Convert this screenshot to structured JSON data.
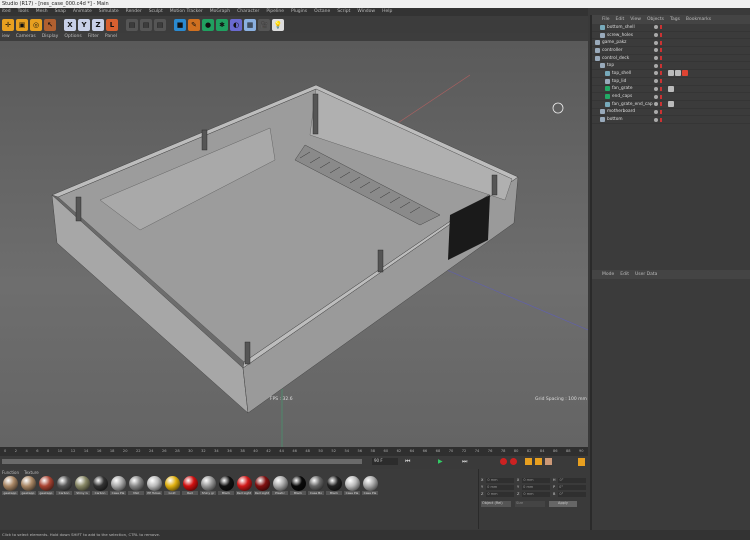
{
  "window": {
    "title": "Studio (R17) - [nes_case_000.c4d *] - Main"
  },
  "menu": [
    "ited",
    "Tools",
    "Mesh",
    "Snap",
    "Animate",
    "Simulate",
    "Render",
    "Sculpt",
    "Motion Tracker",
    "MoGraph",
    "Character",
    "Pipeline",
    "Plugins",
    "Octane",
    "Script",
    "Window",
    "Help"
  ],
  "toolbar": {
    "icons": [
      {
        "name": "move-icon",
        "color": "#e8a020",
        "glyph": "✛"
      },
      {
        "name": "scale-icon",
        "color": "#e8a020",
        "glyph": "▣"
      },
      {
        "name": "rotate-icon",
        "color": "#e8a020",
        "glyph": "◎"
      },
      {
        "name": "select-icon",
        "color": "#b06030",
        "glyph": "↖"
      },
      {
        "name": "x-axis-icon",
        "color": "#c8d0e8",
        "glyph": "X"
      },
      {
        "name": "y-axis-icon",
        "color": "#c8d0e8",
        "glyph": "Y"
      },
      {
        "name": "z-axis-icon",
        "color": "#c8d0e8",
        "glyph": "Z"
      },
      {
        "name": "coordinate-system-icon",
        "color": "#d86030",
        "glyph": "L"
      },
      {
        "name": "render-view-icon",
        "color": "#555",
        "glyph": "▤"
      },
      {
        "name": "render-picture-icon",
        "color": "#555",
        "glyph": "▤"
      },
      {
        "name": "render-settings-icon",
        "color": "#555",
        "glyph": "▤"
      },
      {
        "name": "cube-icon",
        "color": "#2a8ad0",
        "glyph": "■"
      },
      {
        "name": "pen-icon",
        "color": "#d07020",
        "glyph": "✎"
      },
      {
        "name": "subdivision-icon",
        "color": "#20a060",
        "glyph": "●"
      },
      {
        "name": "array-icon",
        "color": "#20a060",
        "glyph": "✱"
      },
      {
        "name": "deformer-icon",
        "color": "#6a6ad0",
        "glyph": "◐"
      },
      {
        "name": "floor-icon",
        "color": "#8ab0e0",
        "glyph": "▦"
      },
      {
        "name": "camera-icon",
        "color": "#555",
        "glyph": "🎥"
      },
      {
        "name": "light-icon",
        "color": "#ddd",
        "glyph": "💡"
      }
    ]
  },
  "viewport_menu": [
    "iew",
    "Cameras",
    "Display",
    "Options",
    "Filter",
    "Panel"
  ],
  "viewport": {
    "fps": "FPS : 32.6",
    "grid_spacing": "Grid Spacing : 100 mm"
  },
  "object_manager": {
    "menu": [
      "File",
      "Edit",
      "View",
      "Objects",
      "Tags",
      "Bookmarks"
    ],
    "objects": [
      {
        "name": "bottom_shell",
        "indent": 1,
        "icon": "#7ab"
      },
      {
        "name": "screw_holes",
        "indent": 1,
        "icon": "#9ab"
      },
      {
        "name": "game_pakz",
        "indent": 0,
        "icon": "#9ab"
      },
      {
        "name": "controller",
        "indent": 0,
        "icon": "#9ab"
      },
      {
        "name": "control_deck",
        "indent": 0,
        "icon": "#9ab"
      },
      {
        "name": "top",
        "indent": 1,
        "icon": "#9ab"
      },
      {
        "name": "top_shell",
        "indent": 2,
        "icon": "#7ab",
        "tags": 3
      },
      {
        "name": "top_lid",
        "indent": 2,
        "icon": "#9ab"
      },
      {
        "name": "fan_grate",
        "indent": 2,
        "icon": "#2a6",
        "tags": 1
      },
      {
        "name": "end_caps",
        "indent": 2,
        "icon": "#2a6"
      },
      {
        "name": "fan_grate_end_cap",
        "indent": 2,
        "icon": "#7ab",
        "tags": 1
      },
      {
        "name": "motherboard",
        "indent": 1,
        "icon": "#9ab"
      },
      {
        "name": "bottom",
        "indent": 1,
        "icon": "#9ab"
      }
    ]
  },
  "attributes": {
    "menu": [
      "Mode",
      "Edit",
      "User Data"
    ]
  },
  "timeline": {
    "ticks": [
      "0",
      "2",
      "4",
      "6",
      "8",
      "10",
      "12",
      "14",
      "16",
      "18",
      "20",
      "22",
      "24",
      "26",
      "28",
      "30",
      "32",
      "34",
      "36",
      "38",
      "40",
      "42",
      "44",
      "46",
      "48",
      "50",
      "52",
      "54",
      "56",
      "58",
      "60",
      "62",
      "64",
      "66",
      "68",
      "70",
      "72",
      "74",
      "76",
      "78",
      "80",
      "82",
      "84",
      "86",
      "88",
      "90"
    ],
    "current_frame": "90 F",
    "end": "0 F"
  },
  "materials": {
    "menu": [
      "Function",
      "Texture"
    ],
    "items": [
      {
        "label": "geekapp",
        "color": "#a86"
      },
      {
        "label": "geekapp",
        "color": "#a86"
      },
      {
        "label": "geekapp",
        "color": "#a43"
      },
      {
        "label": "Carbon",
        "color": "#555"
      },
      {
        "label": "Shiny G",
        "color": "#886"
      },
      {
        "label": "Carbon",
        "color": "#333"
      },
      {
        "label": "Case Pla",
        "color": "#aaa"
      },
      {
        "label": "Mat",
        "color": "#888"
      },
      {
        "label": "PP Tubes",
        "color": "#bbb"
      },
      {
        "label": "Gold",
        "color": "#e0b010"
      },
      {
        "label": "Red",
        "color": "#d01010"
      },
      {
        "label": "Shiny gr",
        "color": "#999"
      },
      {
        "label": "Black",
        "color": "#111"
      },
      {
        "label": "Red Light",
        "color": "#d01818"
      },
      {
        "label": "Red Light",
        "color": "#801010"
      },
      {
        "label": "Plastic",
        "color": "#aaa"
      },
      {
        "label": "Black",
        "color": "#0a0a0a"
      },
      {
        "label": "Case Bo",
        "color": "#666"
      },
      {
        "label": "Black",
        "color": "#222"
      },
      {
        "label": "Case Pla",
        "color": "#bbb"
      },
      {
        "label": "Case Pla",
        "color": "#aaa"
      }
    ]
  },
  "coordinates": {
    "rows": [
      [
        "X",
        "0 mm",
        "X",
        "0 mm",
        "H",
        "0°"
      ],
      [
        "Y",
        "0 mm",
        "Y",
        "0 mm",
        "P",
        "0°"
      ],
      [
        "Z",
        "0 mm",
        "Z",
        "0 mm",
        "B",
        "0°"
      ]
    ],
    "mode": "Object (Rel)",
    "size_mode": "Size",
    "apply": "Apply"
  },
  "status": "Click to select elements. Hold down SHIFT to add to the selection, CTRL to remove."
}
